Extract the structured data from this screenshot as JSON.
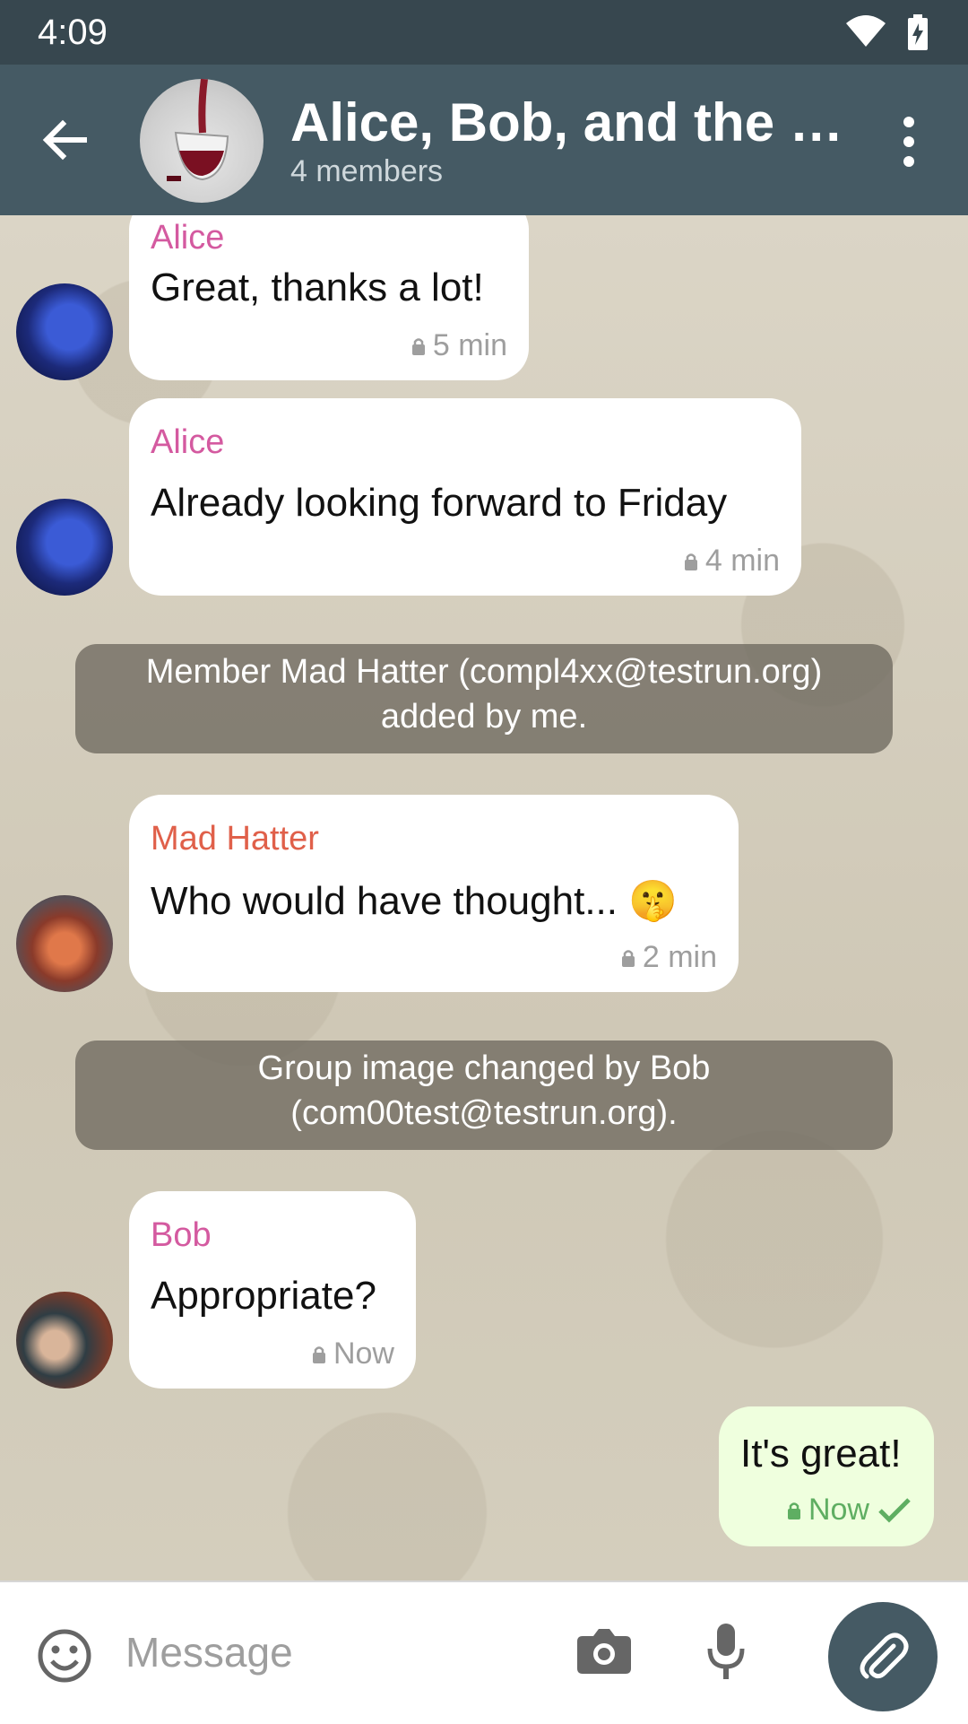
{
  "status_bar": {
    "time": "4:09",
    "wifi_icon": "wifi-icon",
    "battery_icon": "battery-charging-icon"
  },
  "app_bar": {
    "back_icon": "arrow-back-icon",
    "title": "Alice, Bob, and the M...",
    "subtitle": "4 members",
    "menu_icon": "more-vert-icon"
  },
  "messages": [
    {
      "type": "incoming",
      "sender": "Alice",
      "text": "Great, thanks a lot!",
      "time": "5 min"
    },
    {
      "type": "incoming",
      "sender": "Alice",
      "text": "Already looking forward to Friday",
      "time": "4 min"
    },
    {
      "type": "system",
      "line1": "Member Mad Hatter (compl4xx@testrun.org)",
      "line2": "added by me."
    },
    {
      "type": "incoming",
      "sender": "Mad Hatter",
      "text": "Who would have thought... 🤫",
      "time": "2 min"
    },
    {
      "type": "system",
      "line1": "Group image changed by Bob",
      "line2": "(com00test@testrun.org)."
    },
    {
      "type": "incoming",
      "sender": "Bob",
      "text": "Appropriate?",
      "time": "Now"
    },
    {
      "type": "outgoing",
      "text": "It's great!",
      "time": "Now",
      "status_icon": "checkmark-icon"
    }
  ],
  "colors": {
    "alice_name": "#d45aa0",
    "bob_name": "#d45aa0",
    "hatter_name": "#e0604a",
    "app_bar": "#455a64",
    "status_bar": "#37474f"
  },
  "composer": {
    "placeholder": "Message",
    "emoji_icon": "emoji-icon",
    "camera_icon": "camera-icon",
    "mic_icon": "microphone-icon",
    "attach_icon": "paperclip-icon"
  }
}
